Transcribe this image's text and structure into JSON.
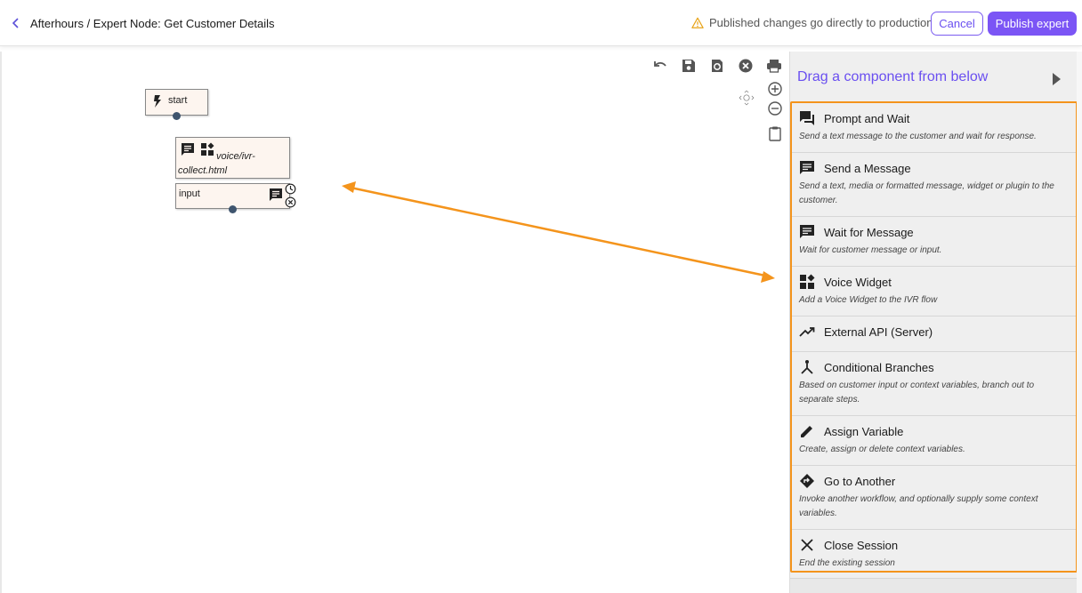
{
  "header": {
    "back_icon": "chevron-left-icon",
    "breadcrumb": "Afterhours / Expert Node: Get Customer Details",
    "warning": "Published changes go directly to production",
    "cancel_label": "Cancel",
    "publish_label": "Publish expert",
    "accent": "#7b55f5",
    "warning_color": "#e8a317"
  },
  "toolbar": {
    "icons": [
      "undo-icon",
      "save-icon",
      "reload-icon",
      "clear-icon",
      "print-icon",
      "navigate-icon",
      "zoom-in-icon",
      "zoom-out-icon",
      "clipboard-icon"
    ]
  },
  "flow": {
    "start_label": "start",
    "node_template": "voice/ivr-collect.html",
    "node_input_label": "input"
  },
  "panel": {
    "title": "Drag a component from below",
    "components": [
      {
        "name": "Prompt and Wait",
        "desc": "Send a text message to the customer and wait for response.",
        "icon": "forum-icon"
      },
      {
        "name": "Send a Message",
        "desc": "Send a text, media or formatted message, widget or plugin to the customer.",
        "icon": "message-icon"
      },
      {
        "name": "Wait for Message",
        "desc": "Wait for customer message or input.",
        "icon": "message-wait-icon"
      },
      {
        "name": "Voice Widget",
        "desc": "Add a Voice Widget to the IVR flow",
        "icon": "widgets-icon"
      },
      {
        "name": "External API (Server)",
        "desc": "",
        "icon": "trending-up-icon"
      },
      {
        "name": "Conditional Branches",
        "desc": "Based on customer input or context variables, branch out to separate steps.",
        "icon": "branch-icon"
      },
      {
        "name": "Assign Variable",
        "desc": "Create, assign or delete context variables.",
        "icon": "pencil-icon"
      },
      {
        "name": "Go to Another",
        "desc": "Invoke another workflow, and optionally supply some context variables.",
        "icon": "directions-icon"
      },
      {
        "name": "Close Session",
        "desc": "End the existing session",
        "icon": "close-icon"
      }
    ]
  },
  "annotation_color": "#f4941c"
}
